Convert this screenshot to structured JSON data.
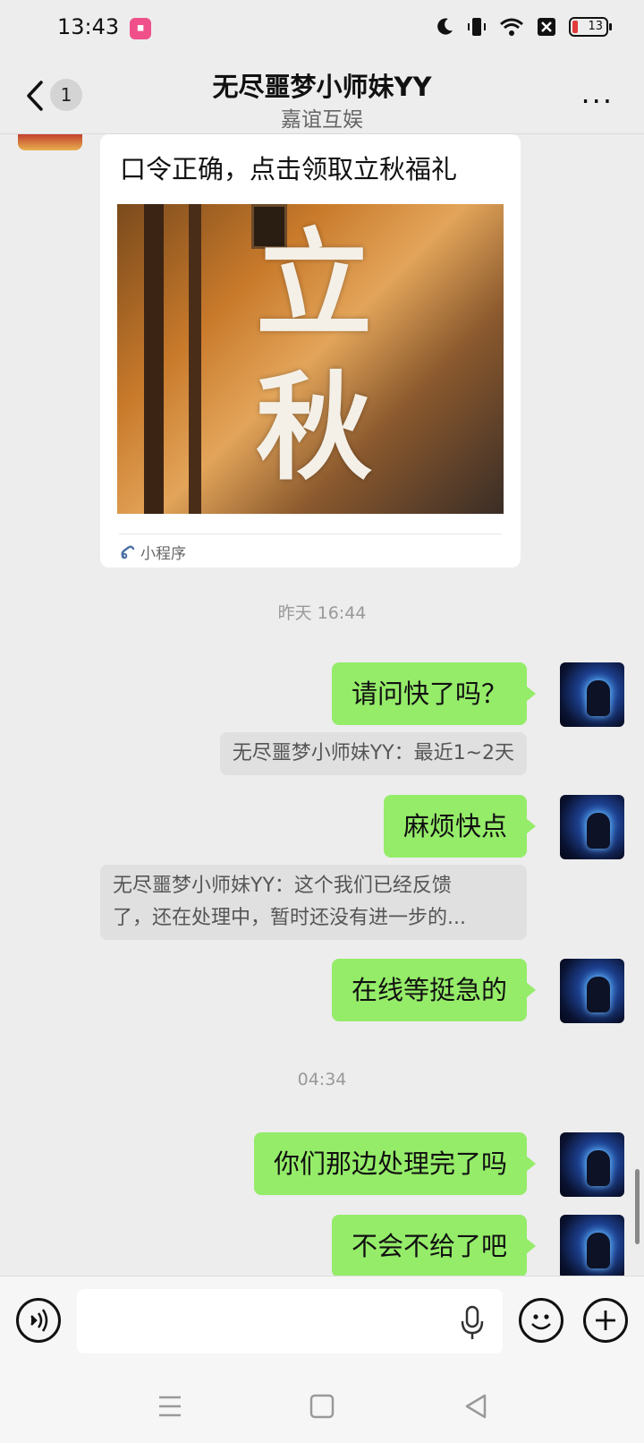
{
  "status_bar": {
    "time": "13:43",
    "app_icon": "app-notification-icon",
    "battery": "13"
  },
  "header": {
    "back_count": "1",
    "title": "无尽噩梦小师妹YY",
    "subtitle": "嘉谊互娱",
    "more": "···"
  },
  "messages": {
    "card": {
      "title": "口令正确，点击领取立秋福礼",
      "image_text": "立秋",
      "footer": "小程序"
    },
    "timestamp_1": "昨天 16:44",
    "msg_1": "请问快了吗？",
    "quote_1": "无尽噩梦小师妹YY：最近1~2天",
    "msg_2": "麻烦快点",
    "quote_2_line1": "无尽噩梦小师妹YY：这个我们已经反馈",
    "quote_2_line2": "了，还在处理中，暂时还没有进一步的...",
    "msg_3": "在线等挺急的",
    "timestamp_2": "04:34",
    "msg_4": "你们那边处理完了吗",
    "msg_5": "不会不给了吧"
  },
  "input_bar": {
    "placeholder": ""
  },
  "colors": {
    "bubble_green": "#95ec69",
    "background": "#ededed"
  }
}
